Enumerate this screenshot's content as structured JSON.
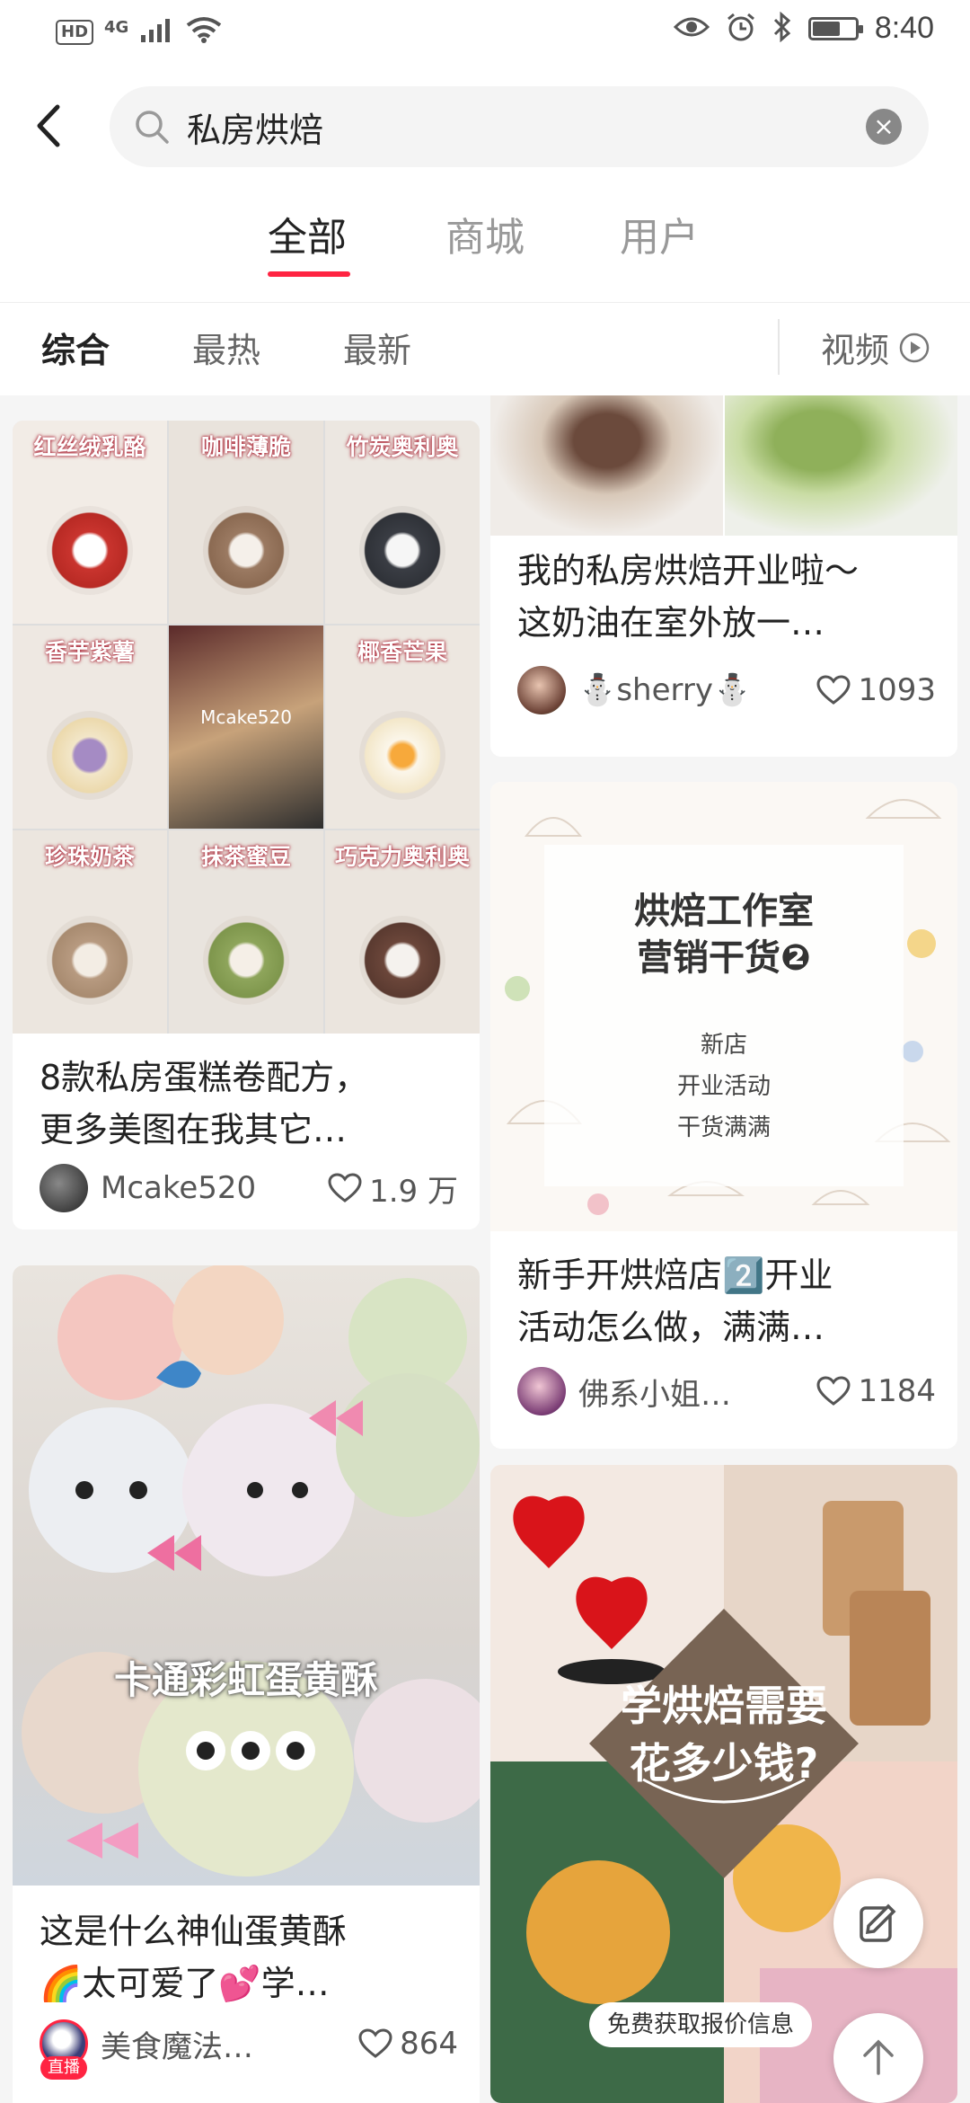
{
  "status_bar": {
    "network_hd": "HD",
    "network_gen": "4G",
    "battery_level": 0.65,
    "time": "8:40"
  },
  "search": {
    "query": "私房烘焙",
    "clear_glyph": "×"
  },
  "tabs": [
    {
      "label": "全部",
      "active": true
    },
    {
      "label": "商城",
      "active": false
    },
    {
      "label": "用户",
      "active": false
    }
  ],
  "filters": [
    {
      "label": "综合",
      "active": true
    },
    {
      "label": "最热",
      "active": false
    },
    {
      "label": "最新",
      "active": false
    }
  ],
  "video_filter": {
    "label": "视频"
  },
  "posts": [
    {
      "image_labels": [
        "红丝绒乳酪",
        "咖啡薄脆",
        "竹炭奥利奥",
        "香芋紫薯",
        "",
        "椰香芒果",
        "珍珠奶茶",
        "抹茶蜜豆",
        "巧克力奥利奥"
      ],
      "watermark": "Mcake520",
      "title_line1": "8款私房蛋糕卷配方，",
      "title_line2": "更多美图在我其它…",
      "author": "Mcake520",
      "likes": "1.9 万"
    },
    {
      "title_line1": "我的私房烘焙开业啦～",
      "title_line2": "这奶油在室外放一…",
      "author": "⛄sherry⛄",
      "likes": "1093"
    },
    {
      "overlay_title_1": "烘焙工作室",
      "overlay_title_2": "营销干货❷",
      "overlay_items": [
        "新店",
        "开业活动",
        "干货满满"
      ],
      "title_line1": "新手开烘焙店2️⃣开业",
      "title_line2": "活动怎么做，满满…",
      "author": "佛系小姐…",
      "likes": "1184"
    },
    {
      "overlay": "卡通彩虹蛋黄酥",
      "title_line1": "这是什么神仙蛋黄酥",
      "title_line2": "🌈太可爱了💕学…",
      "author": "美食魔法…",
      "live_badge": "直播",
      "likes": "864"
    },
    {
      "overlay_line1": "学烘焙需要",
      "overlay_line2": "花多少钱?",
      "cta": "免费获取报价信息"
    }
  ]
}
